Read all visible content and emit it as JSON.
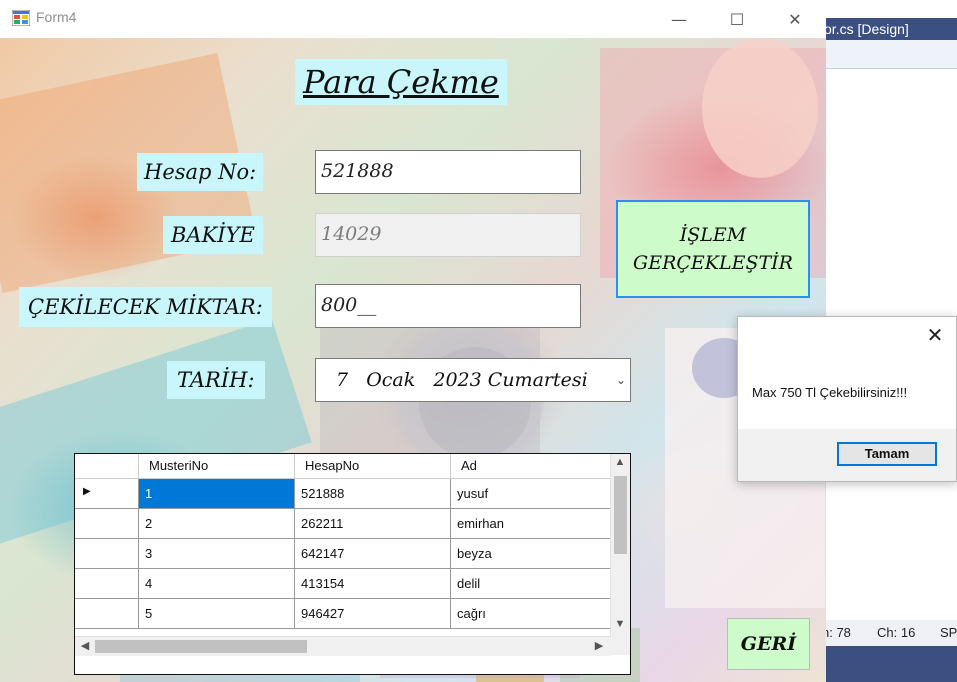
{
  "ide": {
    "tab_label": "or.cs [Design]",
    "status_ln": "n: 78",
    "status_ch": "Ch: 16",
    "status_extra": "SP"
  },
  "window": {
    "title": "Form4",
    "minimize_glyph": "—",
    "maximize_glyph": "☐",
    "close_glyph": "✕"
  },
  "form": {
    "heading": "Para Çekme",
    "hesap_no_label": "Hesap No:",
    "hesap_no_value": "521888",
    "bakiye_label": "BAKİYE",
    "bakiye_value": "14029",
    "miktar_label": "ÇEKİLECEK MİKTAR:",
    "miktar_value": "800__",
    "tarih_label": "TARİH:",
    "tarih_value": "7   Ocak   2023 Cumartesi",
    "islem_button_line1": "İŞLEM",
    "islem_button_line2": "GERÇEKLEŞTİR",
    "geri_button": "GERİ"
  },
  "grid": {
    "columns": [
      "MusteriNo",
      "HesapNo",
      "Ad"
    ],
    "rows": [
      {
        "musteri_no": "1",
        "hesap_no": "521888",
        "ad": "yusuf"
      },
      {
        "musteri_no": "2",
        "hesap_no": "262211",
        "ad": "emirhan"
      },
      {
        "musteri_no": "3",
        "hesap_no": "642147",
        "ad": "beyza"
      },
      {
        "musteri_no": "4",
        "hesap_no": "413154",
        "ad": "delil"
      },
      {
        "musteri_no": "5",
        "hesap_no": "946427",
        "ad": "cağrı"
      }
    ],
    "current_row_marker": "▶"
  },
  "messagebox": {
    "message": "Max 750 Tl Çekebilirsiniz!!!",
    "ok_label": "Tamam",
    "close_glyph": "✕"
  },
  "colors": {
    "label_bg": "#c8f6fa",
    "button_bg": "#cdfbc9",
    "selection": "#0078d7",
    "ide_blue": "#3b4f81"
  }
}
